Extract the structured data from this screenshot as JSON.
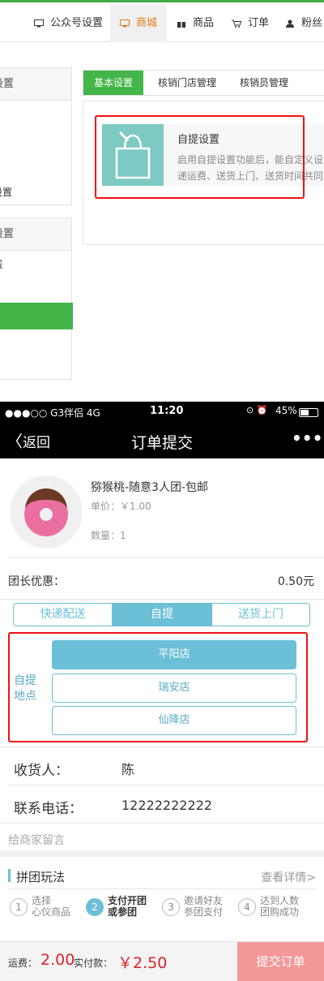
{
  "admin": {
    "nav": [
      {
        "label": "公众号设置",
        "icon": "monitor-icon"
      },
      {
        "label": "商城",
        "icon": "monitor-icon",
        "active": true
      },
      {
        "label": "商品",
        "icon": "gift-icon"
      },
      {
        "label": "订单",
        "icon": "cart-icon"
      },
      {
        "label": "粉丝",
        "icon": "user-icon"
      }
    ],
    "left_panel_1": {
      "header": "设置",
      "item": "设置"
    },
    "left_panel_2": {
      "header": "设置",
      "item": "城"
    },
    "tabs": [
      "基本设置",
      "核销门店管理",
      "核销员管理"
    ],
    "card": {
      "title": "自提设置",
      "desc_line1": "启用自提设置功能后，能自定义设",
      "desc_line2": "递运费、送货上门、送货时间共同"
    }
  },
  "phone": {
    "status": {
      "carrier": "●●●○○ G3伴侣  4G",
      "time": "11:20",
      "battery": "45%"
    },
    "titlebar": {
      "back": "返回",
      "title": "订单提交",
      "more": "•••"
    },
    "product": {
      "name": "猕猴桃-随意3人团-包邮",
      "price": "单价：￥1.00",
      "qty": "数量：1"
    },
    "discount": {
      "label": "团长优惠：",
      "value": "0.50元"
    },
    "delivery_tabs": [
      "快递配送",
      "自提",
      "送货上门"
    ],
    "delivery_selected": 1,
    "pickup": {
      "label_line1": "自提",
      "label_line2": "地点",
      "stores": [
        "平阳店",
        "瑞安店",
        "仙降店"
      ],
      "selected": 0
    },
    "receiver": {
      "label": "收货人：",
      "value": "陈"
    },
    "phone_row": {
      "label": "联系电话：",
      "value": "12222222222"
    },
    "message_placeholder": "给商家留言",
    "group": {
      "title": "拼团玩法",
      "details": "查看详情>"
    },
    "steps": [
      {
        "num": "1",
        "line1": "选择",
        "line2": "心仪商品"
      },
      {
        "num": "2",
        "line1": "支付开团",
        "line2": "或参团",
        "current": true
      },
      {
        "num": "3",
        "line1": "邀请好友",
        "line2": "参团支付"
      },
      {
        "num": "4",
        "line1": "达到人数",
        "line2": "团购成功"
      }
    ],
    "footer": {
      "fee_label": "运费：",
      "fee_value": "2.00",
      "pay_label": "实付款：",
      "pay_value": "￥2.50",
      "submit": "提交订单"
    }
  }
}
